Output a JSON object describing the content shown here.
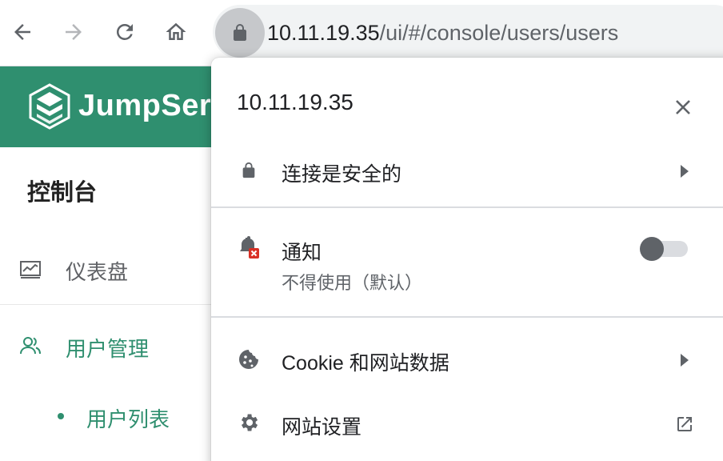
{
  "browser": {
    "url_host": "10.11.19.35",
    "url_path": "/ui/#/console/users/users",
    "back_icon": "arrow-left-icon",
    "forward_icon": "arrow-right-icon",
    "reload_icon": "reload-icon",
    "home_icon": "home-icon",
    "site_info_icon": "lock-icon"
  },
  "app": {
    "brand_name": "JumpSer",
    "brand_color": "#2f8f6f"
  },
  "sidebar": {
    "title": "控制台",
    "items": [
      {
        "label": "仪表盘",
        "icon": "dashboard-icon"
      },
      {
        "label": "用户管理",
        "icon": "users-icon"
      }
    ],
    "sub_items": [
      {
        "label": "用户列表"
      }
    ]
  },
  "site_info": {
    "host": "10.11.19.35",
    "close_icon": "close-icon",
    "connection": {
      "label": "连接是安全的",
      "icon": "lock-icon"
    },
    "notifications": {
      "label": "通知",
      "status": "不得使用（默认）",
      "icon": "bell-blocked-icon",
      "enabled": false
    },
    "cookies": {
      "label": "Cookie 和网站数据",
      "icon": "cookie-icon"
    },
    "site_settings": {
      "label": "网站设置",
      "icon": "gear-icon"
    }
  }
}
